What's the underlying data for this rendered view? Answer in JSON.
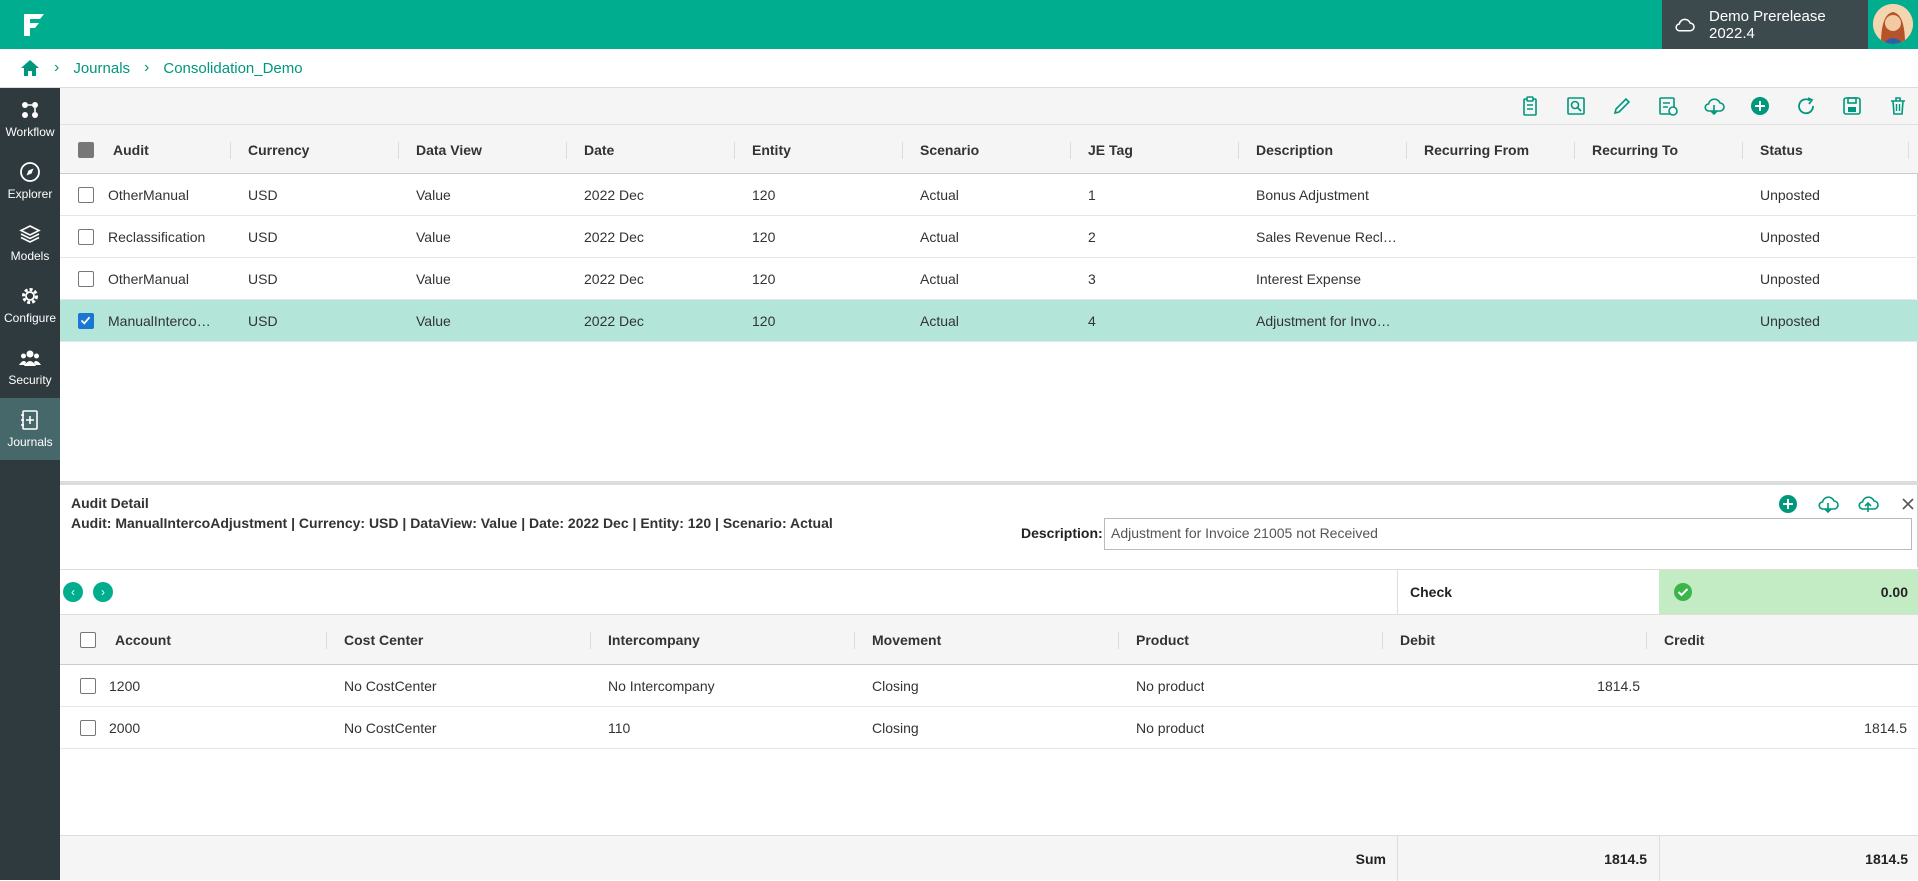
{
  "env": {
    "label": "Demo Prerelease 2022.4"
  },
  "breadcrumb": {
    "items": [
      "Journals",
      "Consolidation_Demo"
    ]
  },
  "sidebar": {
    "items": [
      {
        "label": "Workflow",
        "icon": "workflow-icon"
      },
      {
        "label": "Explorer",
        "icon": "compass-icon"
      },
      {
        "label": "Models",
        "icon": "layers-icon"
      },
      {
        "label": "Configure",
        "icon": "gear-icon"
      },
      {
        "label": "Security",
        "icon": "users-icon"
      },
      {
        "label": "Journals",
        "icon": "journal-icon"
      }
    ]
  },
  "journals": {
    "columns": [
      "Audit",
      "Currency",
      "Data View",
      "Date",
      "Entity",
      "Scenario",
      "JE Tag",
      "Description",
      "Recurring From",
      "Recurring To",
      "Status"
    ],
    "rows": [
      {
        "audit": "OtherManual",
        "currency": "USD",
        "dataview": "Value",
        "date": "2022 Dec",
        "entity": "120",
        "scenario": "Actual",
        "jetag": "1",
        "description": "Bonus Adjustment",
        "recfrom": "",
        "recto": "",
        "status": "Unposted",
        "checked": false
      },
      {
        "audit": "Reclassification",
        "currency": "USD",
        "dataview": "Value",
        "date": "2022 Dec",
        "entity": "120",
        "scenario": "Actual",
        "jetag": "2",
        "description": "Sales Revenue Recl…",
        "recfrom": "",
        "recto": "",
        "status": "Unposted",
        "checked": false
      },
      {
        "audit": "OtherManual",
        "currency": "USD",
        "dataview": "Value",
        "date": "2022 Dec",
        "entity": "120",
        "scenario": "Actual",
        "jetag": "3",
        "description": "Interest Expense",
        "recfrom": "",
        "recto": "",
        "status": "Unposted",
        "checked": false
      },
      {
        "audit": "ManualInterco…",
        "currency": "USD",
        "dataview": "Value",
        "date": "2022 Dec",
        "entity": "120",
        "scenario": "Actual",
        "jetag": "4",
        "description": "Adjustment for Invo…",
        "recfrom": "",
        "recto": "",
        "status": "Unposted",
        "checked": true
      }
    ]
  },
  "detail": {
    "title": "Audit Detail",
    "info": "Audit: ManualIntercoAdjustment |  Currency: USD |  DataView: Value |  Date: 2022 Dec |  Entity: 120 |  Scenario: Actual",
    "description_label": "Description:",
    "description_value": "Adjustment for Invoice 21005 not Received",
    "check_label": "Check",
    "check_value": "0.00",
    "columns": [
      "Account",
      "Cost Center",
      "Intercompany",
      "Movement",
      "Product",
      "Debit",
      "Credit"
    ],
    "rows": [
      {
        "account": "1200",
        "costcenter": "No CostCenter",
        "intercompany": "No Intercompany",
        "movement": "Closing",
        "product": "No product",
        "debit": "1814.5",
        "credit": ""
      },
      {
        "account": "2000",
        "costcenter": "No CostCenter",
        "intercompany": "110",
        "movement": "Closing",
        "product": "No product",
        "debit": "",
        "credit": "1814.5"
      }
    ],
    "sum_label": "Sum",
    "sum_debit": "1814.5",
    "sum_credit": "1814.5"
  }
}
